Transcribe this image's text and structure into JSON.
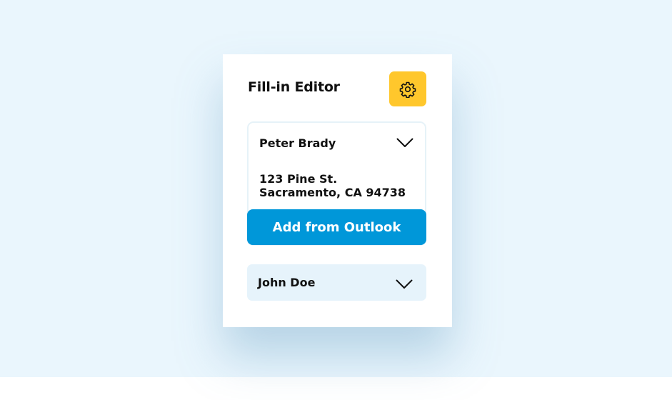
{
  "editor": {
    "title": "Fill-in Editor",
    "settings_icon": "gear-icon",
    "accent_color": "#ffc72c"
  },
  "contacts": [
    {
      "name": "Peter Brady",
      "expanded": true,
      "address_line1": "123 Pine St.",
      "address_line2": "Sacramento, CA 94738",
      "icon": "chevron-down-icon"
    },
    {
      "name": "John Doe",
      "expanded": false,
      "icon": "chevron-down-icon"
    }
  ],
  "actions": {
    "add_from_outlook": "Add from Outlook",
    "button_color": "#0097d9"
  }
}
